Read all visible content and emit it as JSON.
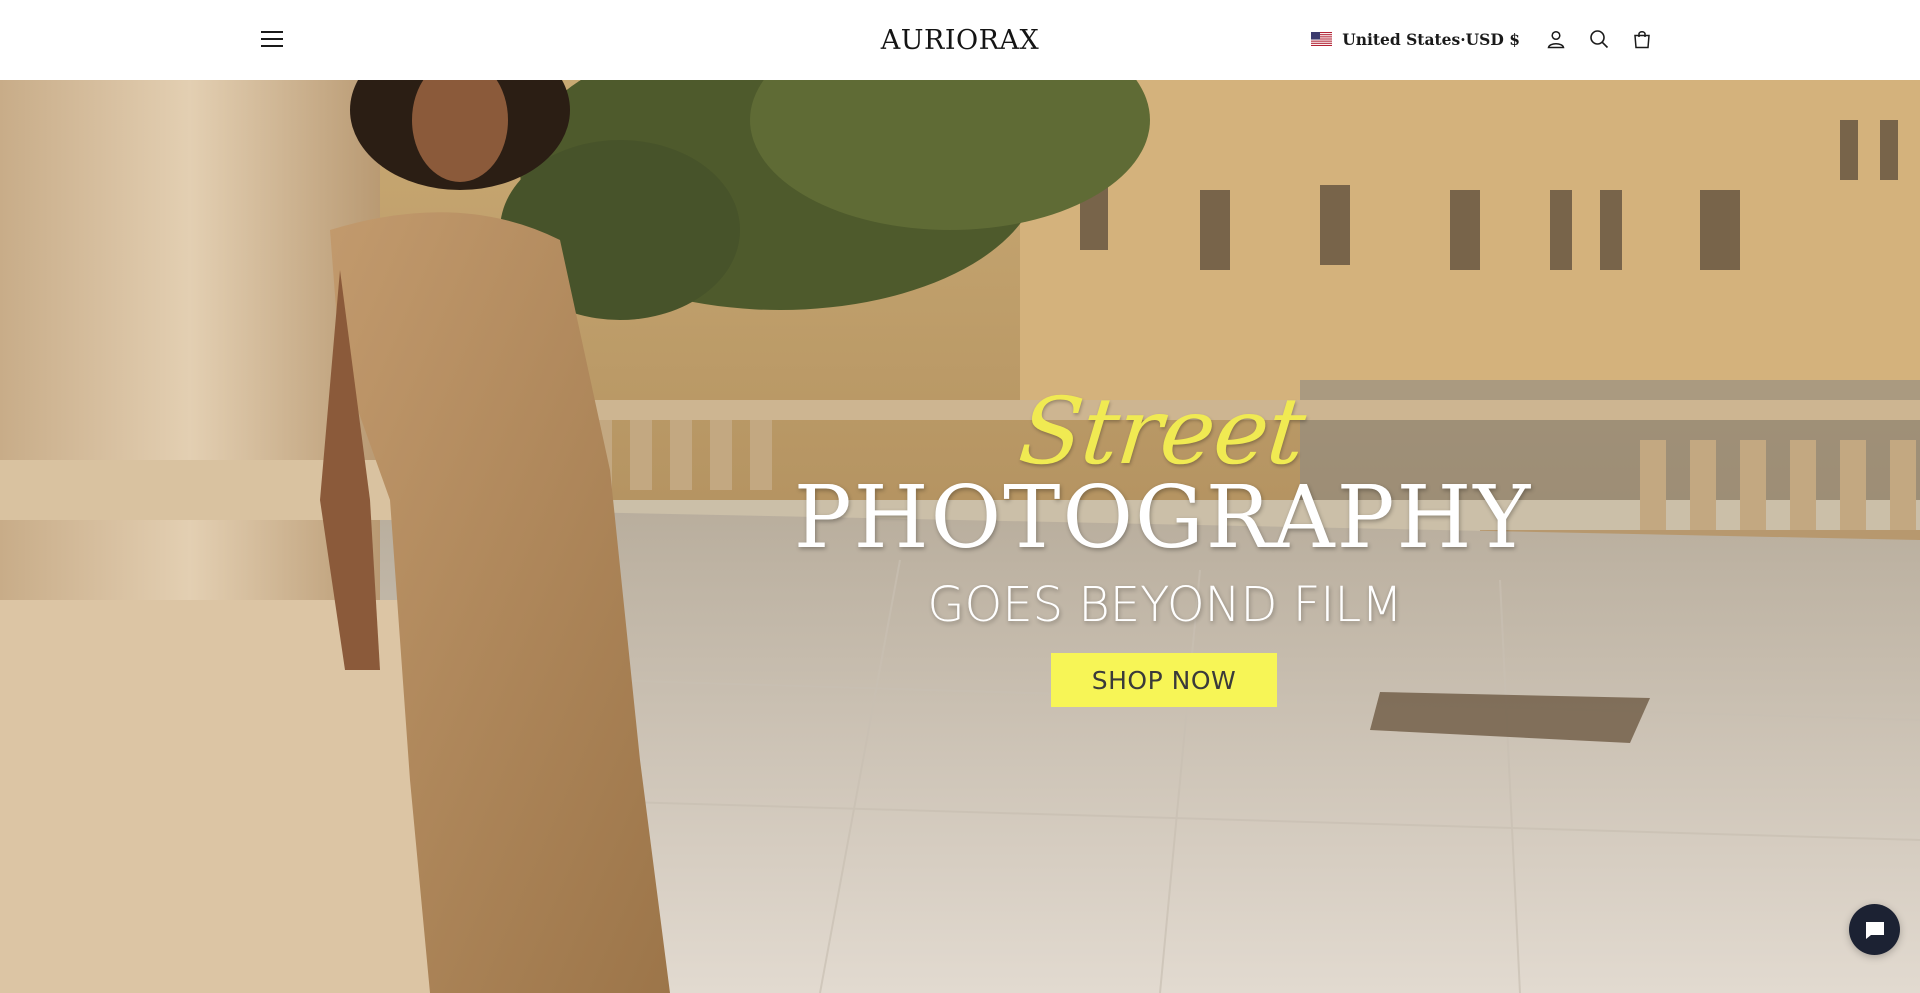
{
  "header": {
    "menu_icon": "hamburger-menu-icon",
    "logo": "AURIORAX",
    "locale": {
      "flag_icon": "us-flag-icon",
      "label": "United States·USD $"
    },
    "icons": [
      "account-icon",
      "search-icon",
      "cart-bag-icon"
    ]
  },
  "hero": {
    "script_title": "Street",
    "title": "PHOTOGRAPHY",
    "subtitle": "GOES BEYOND FILM",
    "cta_label": "SHOP NOW",
    "colors": {
      "script_accent": "#f0ea52",
      "cta_background": "#f7f556",
      "title_color": "#ffffff"
    }
  },
  "chat": {
    "icon": "chat-bubble-icon",
    "background": "#1c2233"
  }
}
